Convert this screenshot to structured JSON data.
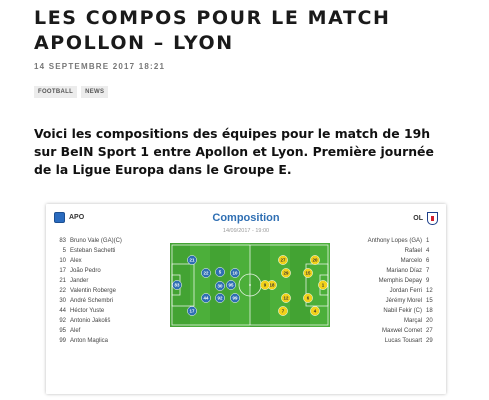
{
  "article": {
    "title": "LES COMPOS POUR LE MATCH APOLLON – LYON",
    "date": "14 SEPTEMBRE 2017 18:21",
    "tags": [
      "FOOTBALL",
      "NEWS"
    ],
    "intro": "Voici les compositions des équipes pour le match de 19h sur BeIN Sport 1 entre Apollon et Lyon. Première journée de la Ligue Europa dans le Groupe E."
  },
  "widget": {
    "title": "Composition",
    "date": "14/09/2017 - 19:00",
    "home": {
      "name": "APO",
      "color": "#2f6fb3",
      "players": [
        {
          "num": "83",
          "name": "Bruno Vale (GA)(C)"
        },
        {
          "num": "5",
          "name": "Esteban Sachetti"
        },
        {
          "num": "10",
          "name": "Alex"
        },
        {
          "num": "17",
          "name": "João Pedro"
        },
        {
          "num": "21",
          "name": "Jander"
        },
        {
          "num": "22",
          "name": "Valentin Roberge"
        },
        {
          "num": "30",
          "name": "André Schembri"
        },
        {
          "num": "44",
          "name": "Héctor Yuste"
        },
        {
          "num": "92",
          "name": "Antonio Jakoliš"
        },
        {
          "num": "95",
          "name": "Alef"
        },
        {
          "num": "99",
          "name": "Anton Maglica"
        }
      ],
      "pitch_numbers": [
        "83",
        "21",
        "17",
        "22",
        "44",
        "5",
        "30",
        "92",
        "95",
        "10",
        "99"
      ]
    },
    "away": {
      "name": "OL",
      "color": "#f2d21b",
      "players": [
        {
          "num": "1",
          "name": "Anthony Lopes (GA)"
        },
        {
          "num": "4",
          "name": "Rafael"
        },
        {
          "num": "6",
          "name": "Marcelo"
        },
        {
          "num": "7",
          "name": "Mariano Díaz"
        },
        {
          "num": "9",
          "name": "Memphis Depay"
        },
        {
          "num": "12",
          "name": "Jordan Ferri"
        },
        {
          "num": "15",
          "name": "Jérémy Morel"
        },
        {
          "num": "18",
          "name": "Nabil Fekir (C)"
        },
        {
          "num": "20",
          "name": "Marçal"
        },
        {
          "num": "27",
          "name": "Maxwel Cornet"
        },
        {
          "num": "29",
          "name": "Lucas Tousart"
        }
      ],
      "pitch_numbers": [
        "1",
        "20",
        "15",
        "6",
        "4",
        "29",
        "12",
        "18",
        "27",
        "7",
        "9"
      ]
    }
  },
  "colors": {
    "pitch_green": "#4caf3a",
    "pitch_stripe": "#43a333",
    "home_dot": "#2f6fb3",
    "away_dot": "#f2d21b"
  }
}
